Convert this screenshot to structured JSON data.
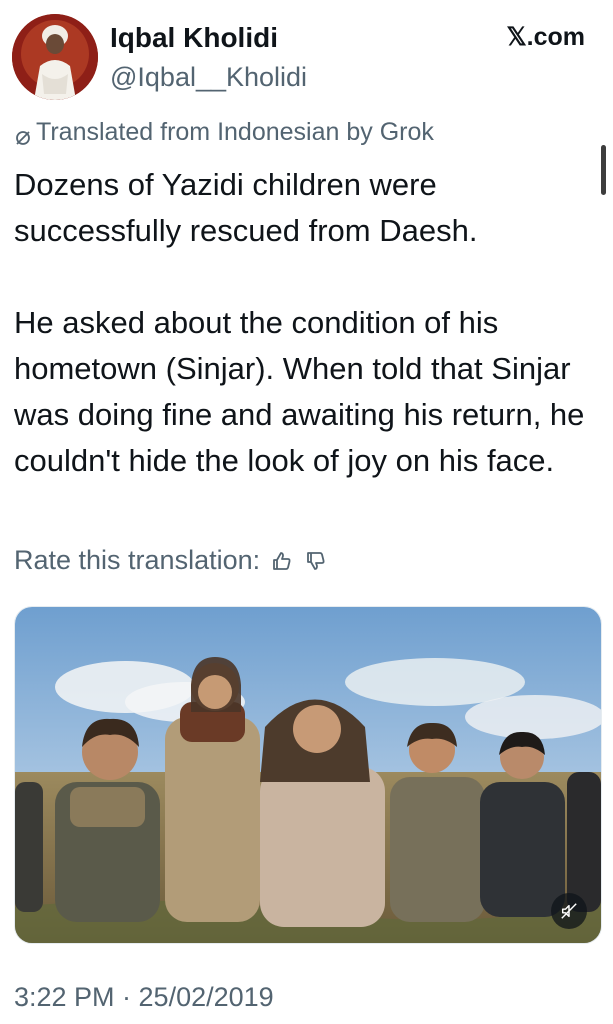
{
  "author": {
    "display_name": "Iqbal Kholidi",
    "handle": "@Iqbal__Kholidi",
    "avatar_icon": "avatar-portrait"
  },
  "source": "𝕏.com",
  "translation": {
    "notice": "Translated from Indonesian by Grok",
    "rate_label": "Rate this translation:",
    "thumbs_up_icon": "thumbs-up-icon",
    "thumbs_down_icon": "thumbs-down-icon"
  },
  "tweet": {
    "paragraph_1": "Dozens of Yazidi children were successfully rescued from Daesh.",
    "paragraph_2": "He asked about the condition of his hometown (Sinjar). When told that Sinjar was doing fine and awaiting his return, he couldn't hide the look of joy on his face."
  },
  "media": {
    "type": "video",
    "mute_icon": "speaker-muted-icon"
  },
  "timestamp": "3:22 PM · 25/02/2019",
  "colors": {
    "text_primary": "#0f1419",
    "text_secondary": "#536471",
    "background": "#ffffff"
  }
}
